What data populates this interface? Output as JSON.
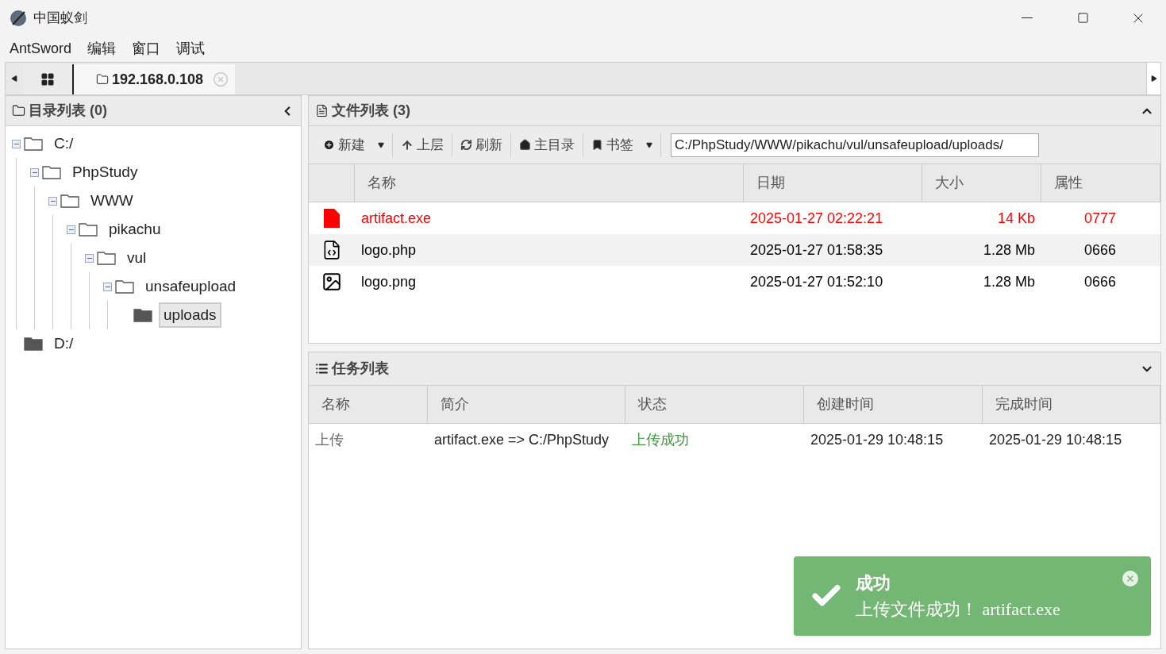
{
  "window": {
    "title": "中国蚁剑"
  },
  "menu": [
    "AntSword",
    "编辑",
    "窗口",
    "调试"
  ],
  "tabs": [
    {
      "kind": "grid",
      "selected": false
    },
    {
      "kind": "host",
      "label": "192.168.0.108",
      "selected": true
    }
  ],
  "dir_panel": {
    "title": "目录列表 (0)",
    "tree": [
      {
        "label": "C:/",
        "expanded": true,
        "selected": false,
        "children": [
          {
            "label": "PhpStudy",
            "expanded": true,
            "selected": false,
            "children": [
              {
                "label": "WWW",
                "expanded": true,
                "selected": false,
                "children": [
                  {
                    "label": "pikachu",
                    "expanded": true,
                    "selected": false,
                    "children": [
                      {
                        "label": "vul",
                        "expanded": true,
                        "selected": false,
                        "children": [
                          {
                            "label": "unsafeupload",
                            "expanded": true,
                            "selected": false,
                            "children": [
                              {
                                "label": "uploads",
                                "expanded": false,
                                "selected": true
                              }
                            ]
                          }
                        ]
                      }
                    ]
                  }
                ]
              }
            ]
          }
        ]
      },
      {
        "label": "D:/",
        "expanded": false,
        "selected": false
      }
    ]
  },
  "file_panel": {
    "title": "文件列表 (3)",
    "toolbar": [
      {
        "kind": "new",
        "label": "新建",
        "dropdown": true
      },
      {
        "kind": "up",
        "label": "上层",
        "dropdown": false
      },
      {
        "kind": "refresh",
        "label": "刷新",
        "dropdown": false
      },
      {
        "kind": "home",
        "label": "主目录",
        "dropdown": false
      },
      {
        "kind": "bookmark",
        "label": "书签",
        "dropdown": true
      }
    ],
    "path": "C:/PhpStudy/WWW/pikachu/vul/unsafeupload/uploads/",
    "columns": [
      "名称",
      "日期",
      "大小",
      "属性"
    ],
    "rows": [
      {
        "kind": "exe",
        "color": "#ff0000",
        "name": "artifact.exe",
        "date": "2025-01-27 02:22:21",
        "size": "14 Kb",
        "mode": "0777"
      },
      {
        "kind": "code",
        "color": "#000000",
        "name": "logo.php",
        "date": "2025-01-27 01:58:35",
        "size": "1.28 Mb",
        "mode": "0666"
      },
      {
        "kind": "image",
        "color": "#000000",
        "name": "logo.png",
        "date": "2025-01-27 01:52:10",
        "size": "1.28 Mb",
        "mode": "0666"
      }
    ]
  },
  "task_panel": {
    "title": "任务列表",
    "columns": [
      "名称",
      "简介",
      "状态",
      "创建时间",
      "完成时间"
    ],
    "rows": [
      {
        "name": "上传",
        "summary": "artifact.exe => C:/PhpStudy",
        "status": "上传成功",
        "created": "2025-01-29 10:48:15",
        "finished": "2025-01-29 10:48:15"
      }
    ]
  },
  "toast": {
    "title": "成功",
    "message": "上传文件成功！ artifact.exe"
  }
}
